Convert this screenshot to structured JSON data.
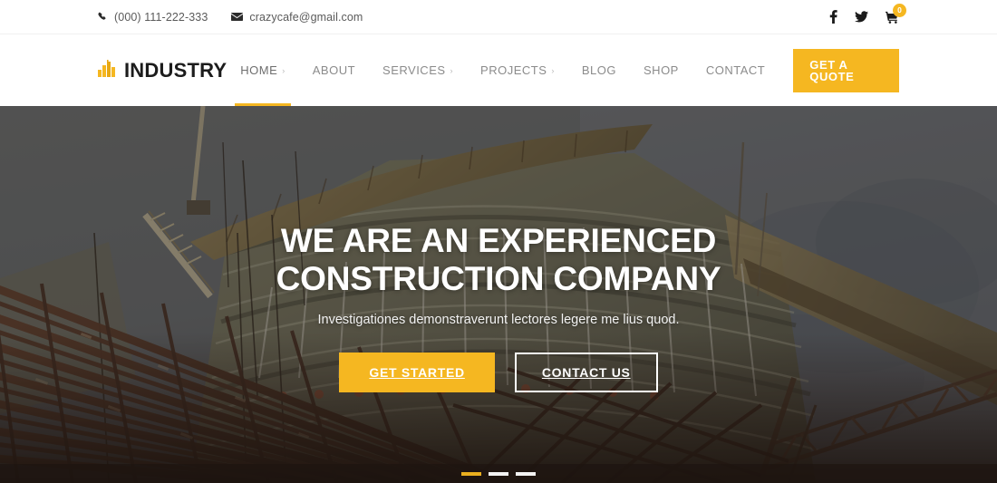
{
  "brand": {
    "name": "INDUSTRY",
    "logo_icon": "building-bars-icon",
    "accent_color": "#f5b721"
  },
  "topbar": {
    "phone": "(000) 111-222-333",
    "phone_icon": "phone-icon",
    "email": "crazycafe@gmail.com",
    "email_icon": "envelope-icon",
    "social": [
      {
        "name": "facebook-icon",
        "label": "f"
      },
      {
        "name": "twitter-icon",
        "label": "t"
      }
    ],
    "cart": {
      "icon": "shopping-cart-icon",
      "count": "0"
    }
  },
  "nav": {
    "items": [
      {
        "label": "HOME",
        "has_dropdown": true,
        "active": true
      },
      {
        "label": "ABOUT",
        "has_dropdown": false,
        "active": false
      },
      {
        "label": "SERVICES",
        "has_dropdown": true,
        "active": false
      },
      {
        "label": "PROJECTS",
        "has_dropdown": true,
        "active": false
      },
      {
        "label": "BLOG",
        "has_dropdown": false,
        "active": false
      },
      {
        "label": "SHOP",
        "has_dropdown": false,
        "active": false
      },
      {
        "label": "CONTACT",
        "has_dropdown": false,
        "active": false
      }
    ],
    "caret_glyph": "›",
    "quote_button": "GET A QUOTE"
  },
  "hero": {
    "title_line1": "WE ARE AN EXPERIENCED",
    "title_line2": "CONSTRUCTION COMPANY",
    "subtitle": "Investigationes demonstraverunt lectores legere me lius quod.",
    "primary_button": "GET STARTED",
    "secondary_button": "CONTACT US",
    "slides": [
      {
        "index": "1",
        "active": true
      },
      {
        "index": "2",
        "active": false
      },
      {
        "index": "3",
        "active": false
      }
    ],
    "scene": "construction-site-rebar-crane"
  }
}
